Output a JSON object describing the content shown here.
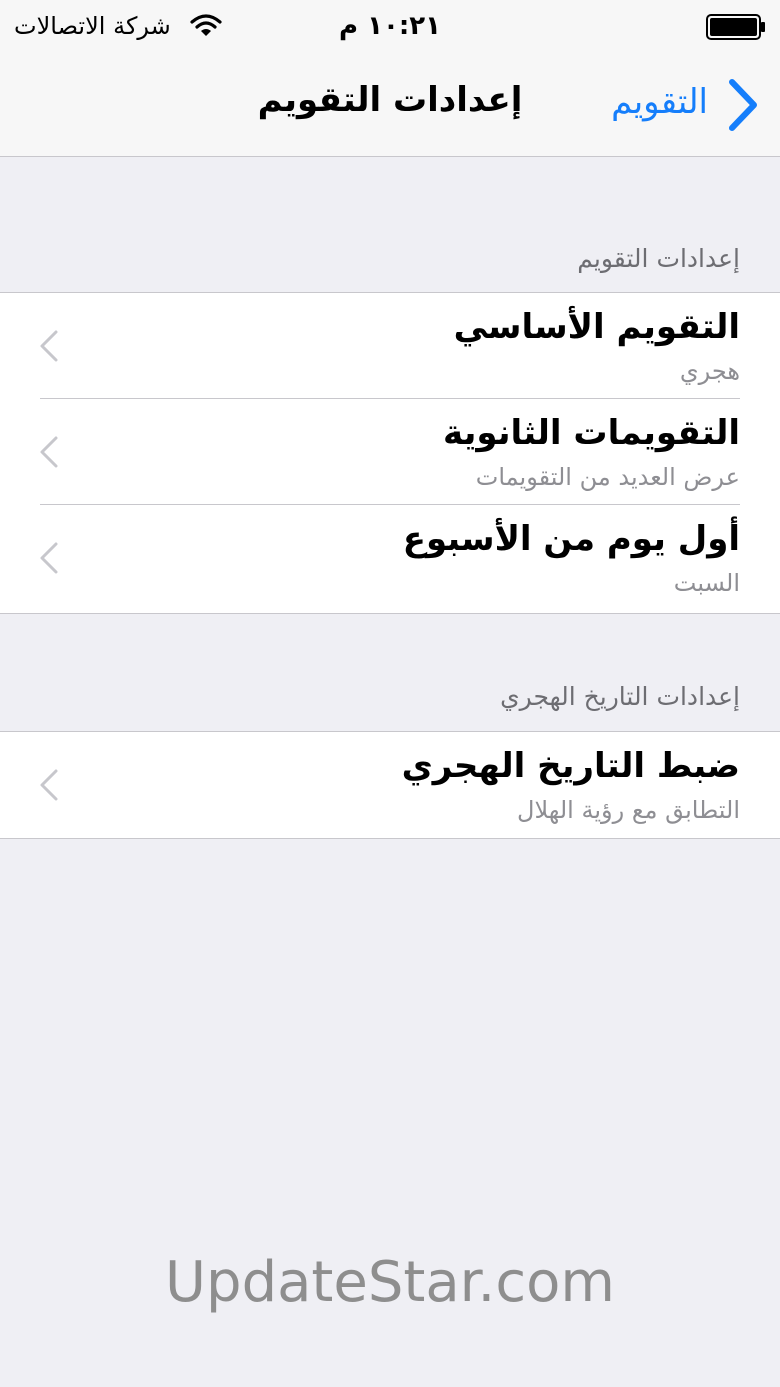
{
  "status_bar": {
    "carrier": "شركة الاتصالات",
    "time": "١٠:٢١ م",
    "wifi_icon": "wifi-icon",
    "battery_icon": "battery-icon"
  },
  "nav": {
    "title": "إعدادات التقويم",
    "back_label": "التقويم",
    "back_icon": "chevron-right-icon",
    "accent_color": "#157efb"
  },
  "sections": [
    {
      "header": "إعدادات التقويم",
      "rows": [
        {
          "title": "التقويم الأساسي",
          "subtitle": "هجري"
        },
        {
          "title": "التقويمات الثانوية",
          "subtitle": "عرض العديد من التقويمات"
        },
        {
          "title": "أول يوم من الأسبوع",
          "subtitle": "السبت"
        }
      ]
    },
    {
      "header": "إعدادات التاريخ الهجري",
      "rows": [
        {
          "title": "ضبط التاريخ الهجري",
          "subtitle": "التطابق مع رؤية الهلال"
        }
      ]
    }
  ],
  "watermark": "UpdateStar.com"
}
